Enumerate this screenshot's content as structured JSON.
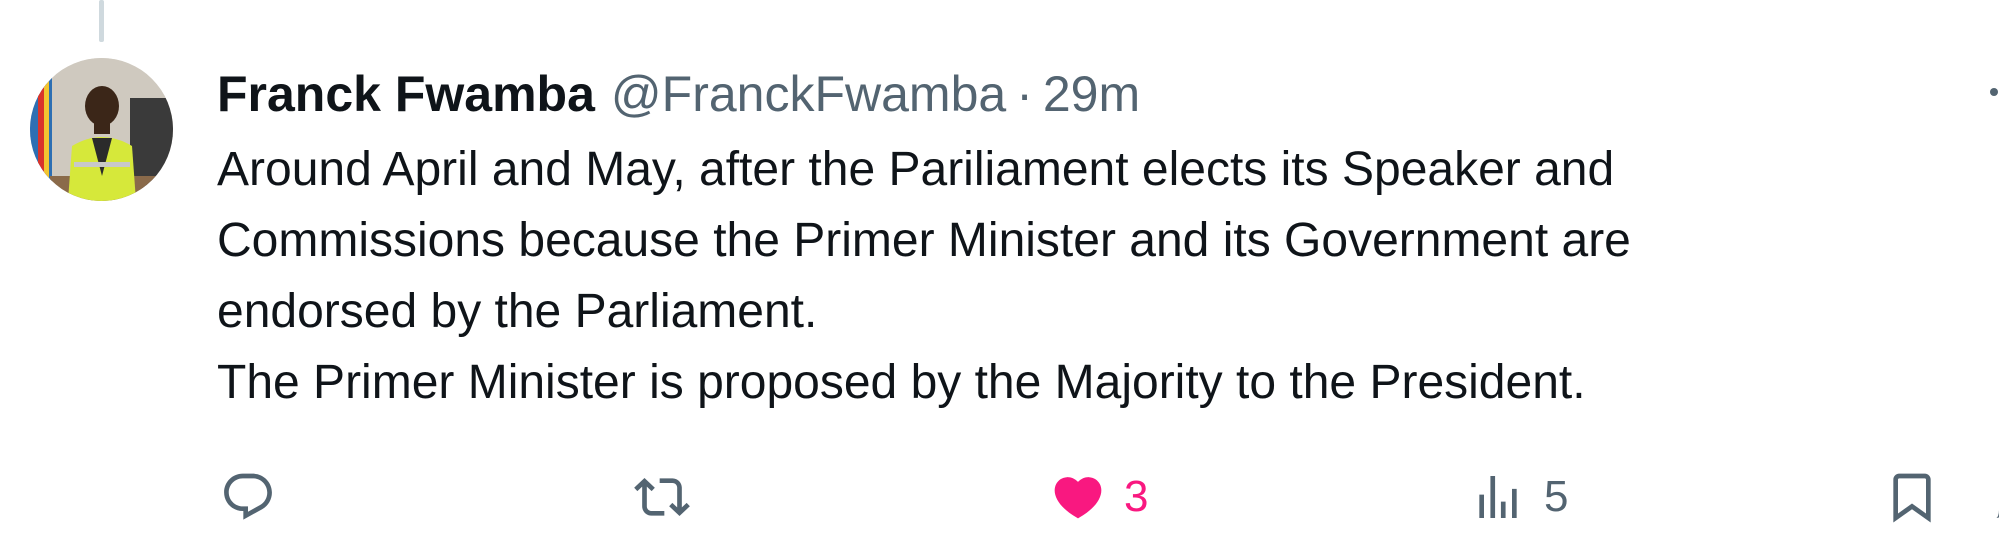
{
  "tweet": {
    "author": {
      "name": "Franck Fwamba",
      "handle": "@FranckFwamba",
      "avatar_icon": "avatar-photo"
    },
    "separator": "·",
    "time": "29m",
    "text_lines": [
      "Around April and May, after the Pariliament elects its Speaker and",
      "Commissions because the Primer Minister and its Government are",
      "endorsed by the Parliament.",
      "The Primer Minister is proposed by the Majority to the President."
    ],
    "actions": {
      "reply": {
        "icon": "reply-icon",
        "count": ""
      },
      "retweet": {
        "icon": "retweet-icon",
        "count": ""
      },
      "like": {
        "icon": "heart-icon",
        "count": "3",
        "liked": true
      },
      "views": {
        "icon": "views-icon",
        "count": "5"
      },
      "bookmark": {
        "icon": "bookmark-icon"
      }
    }
  },
  "colors": {
    "primary_text": "#0f1419",
    "secondary_text": "#536471",
    "like_pink": "#f91880",
    "thread_line": "#cfd9de"
  }
}
